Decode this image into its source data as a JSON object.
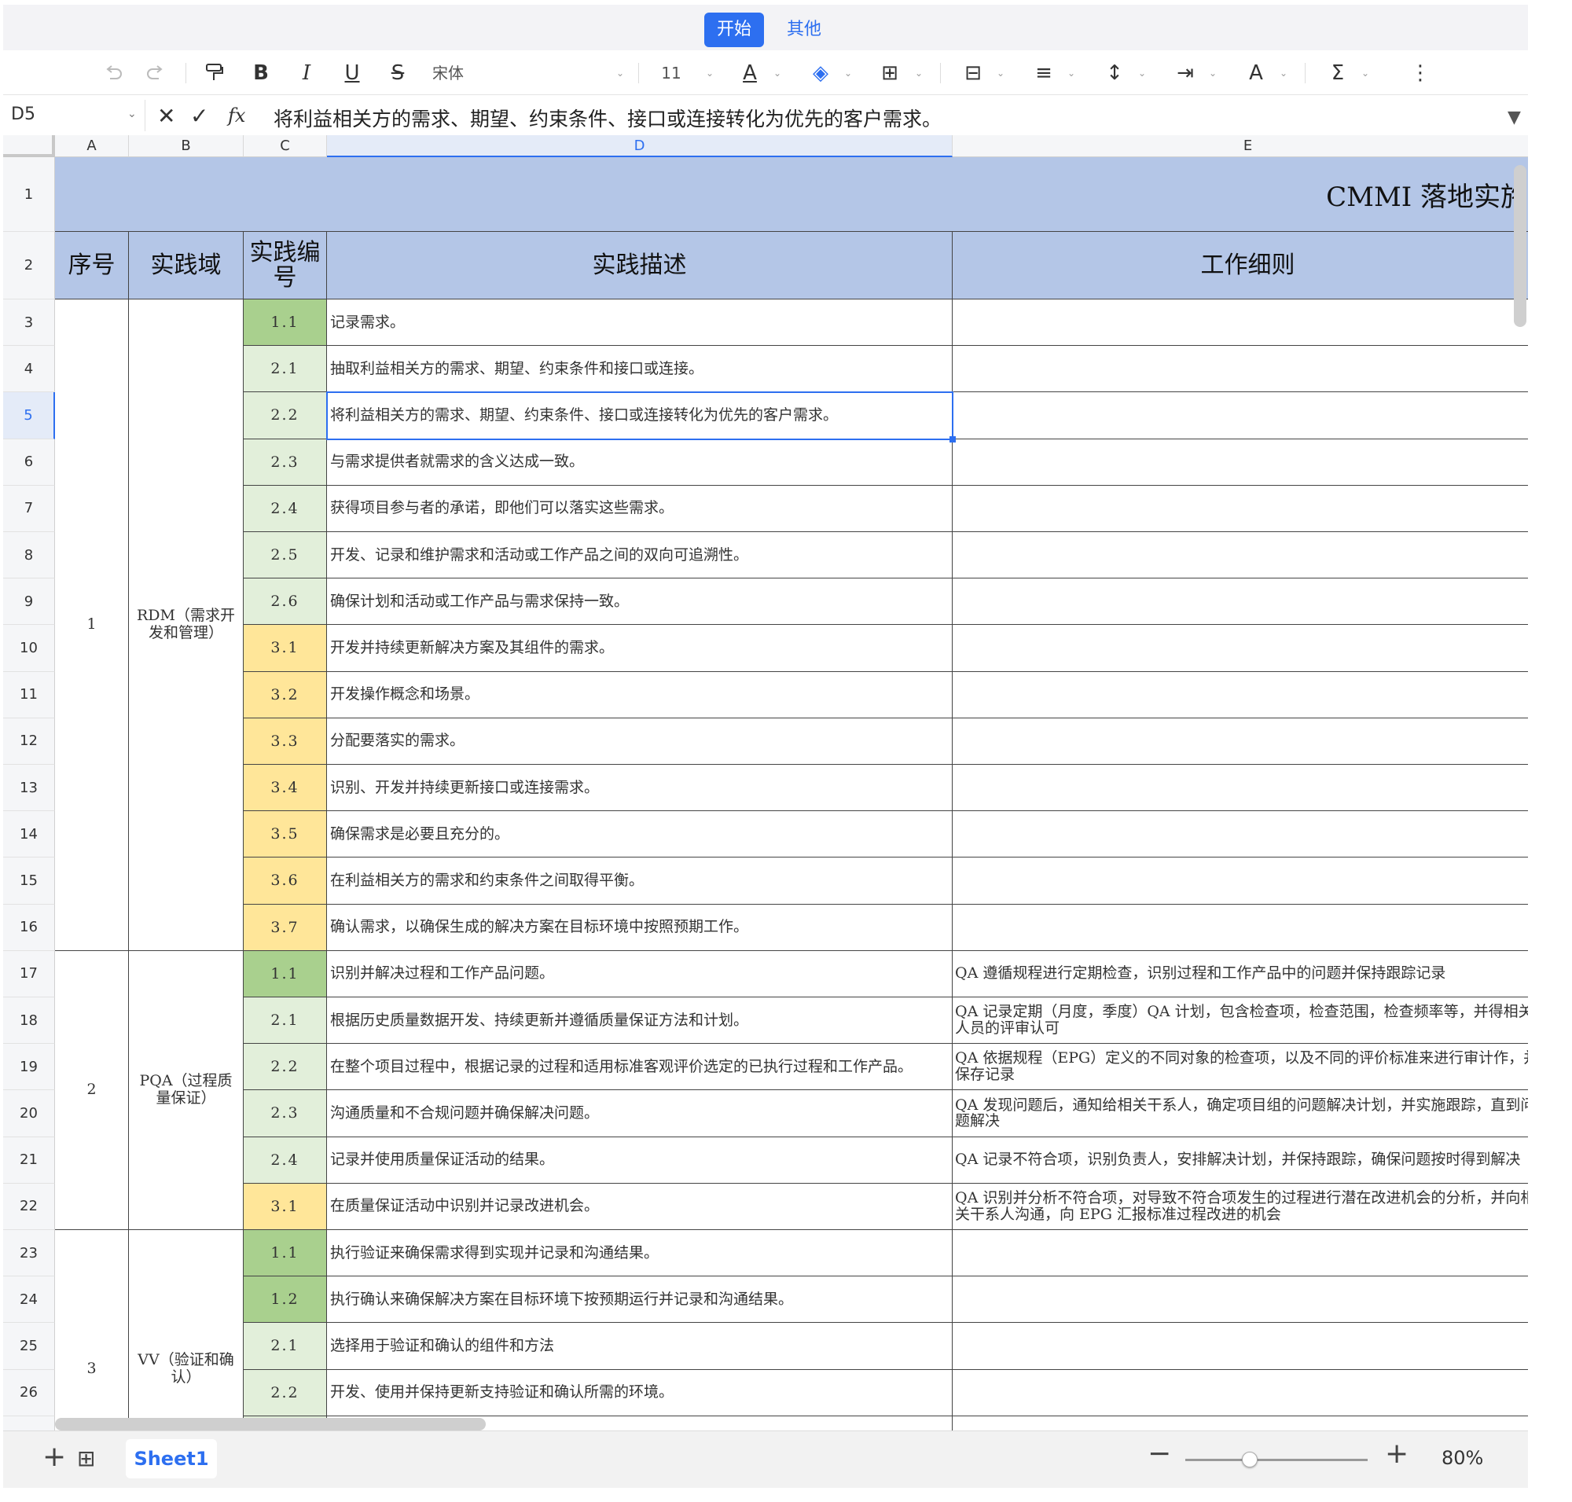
{
  "top_tabs": {
    "start": "开始",
    "other": "其他"
  },
  "toolbar": {
    "undo_icon": "undo-icon",
    "redo_icon": "redo-icon",
    "format_painter_icon": "format-painter-icon",
    "bold": "B",
    "italic": "I",
    "underline": "U",
    "strike": "S",
    "font_name": "宋体",
    "font_size": "11",
    "font_color_glyph": "A",
    "fill_glyph": "◈",
    "border_glyph": "⊞",
    "merge_glyph": "⊟",
    "align_glyph": "≡",
    "valign_glyph": "↕",
    "wrap_glyph": "⇥",
    "text_dir_glyph": "A",
    "sum_glyph": "Σ",
    "more_glyph": "⋮",
    "accent_color": "#2d6ff0"
  },
  "formula_bar": {
    "cell_ref": "D5",
    "cancel_glyph": "✕",
    "confirm_glyph": "✓",
    "fx_label": "fx",
    "content": "将利益相关方的需求、期望、约束条件、接口或连接转化为优先的客户需求。",
    "expand_glyph": "▼"
  },
  "columns": [
    "A",
    "B",
    "C",
    "D",
    "E"
  ],
  "selected_cell": "D5",
  "sheet": {
    "title": "CMMI 落地实施",
    "headers": [
      "序号",
      "实践域",
      "实践编号",
      "实践描述",
      "工作细则"
    ],
    "groups": [
      {
        "seq": "1",
        "domain": "RDM（需求开发和管理）"
      },
      {
        "seq": "2",
        "domain": "PQA（过程质量保证）"
      },
      {
        "seq": "3",
        "domain": "VV（验证和确认）"
      }
    ],
    "rows": [
      {
        "row": "3",
        "code": "1.1",
        "level": 1,
        "desc": "记录需求。",
        "detail": ""
      },
      {
        "row": "4",
        "code": "2.1",
        "level": 2,
        "desc": "抽取利益相关方的需求、期望、约束条件和接口或连接。",
        "detail": ""
      },
      {
        "row": "5",
        "code": "2.2",
        "level": 2,
        "desc": "将利益相关方的需求、期望、约束条件、接口或连接转化为优先的客户需求。",
        "detail": ""
      },
      {
        "row": "6",
        "code": "2.3",
        "level": 2,
        "desc": "与需求提供者就需求的含义达成一致。",
        "detail": ""
      },
      {
        "row": "7",
        "code": "2.4",
        "level": 2,
        "desc": "获得项目参与者的承诺，即他们可以落实这些需求。",
        "detail": ""
      },
      {
        "row": "8",
        "code": "2.5",
        "level": 2,
        "desc": "开发、记录和维护需求和活动或工作产品之间的双向可追溯性。",
        "detail": ""
      },
      {
        "row": "9",
        "code": "2.6",
        "level": 2,
        "desc": "确保计划和活动或工作产品与需求保持一致。",
        "detail": ""
      },
      {
        "row": "10",
        "code": "3.1",
        "level": 3,
        "desc": "开发并持续更新解决方案及其组件的需求。",
        "detail": ""
      },
      {
        "row": "11",
        "code": "3.2",
        "level": 3,
        "desc": "开发操作概念和场景。",
        "detail": ""
      },
      {
        "row": "12",
        "code": "3.3",
        "level": 3,
        "desc": "分配要落实的需求。",
        "detail": ""
      },
      {
        "row": "13",
        "code": "3.4",
        "level": 3,
        "desc": "识别、开发并持续更新接口或连接需求。",
        "detail": ""
      },
      {
        "row": "14",
        "code": "3.5",
        "level": 3,
        "desc": "确保需求是必要且充分的。",
        "detail": ""
      },
      {
        "row": "15",
        "code": "3.6",
        "level": 3,
        "desc": "在利益相关方的需求和约束条件之间取得平衡。",
        "detail": ""
      },
      {
        "row": "16",
        "code": "3.7",
        "level": 3,
        "desc": "确认需求，以确保生成的解决方案在目标环境中按照预期工作。",
        "detail": ""
      },
      {
        "row": "17",
        "code": "1.1",
        "level": 1,
        "desc": "识别并解决过程和工作产品问题。",
        "detail": "QA 遵循规程进行定期检查，识别过程和工作产品中的问题并保持跟踪记录"
      },
      {
        "row": "18",
        "code": "2.1",
        "level": 2,
        "desc": "根据历史质量数据开发、持续更新并遵循质量保证方法和计划。",
        "detail": "QA 记录定期（月度，季度）QA 计划，包含检查项，检查范围，检查频率等，并得相关人员的评审认可"
      },
      {
        "row": "19",
        "code": "2.2",
        "level": 2,
        "desc": "在整个项目过程中，根据记录的过程和适用标准客观评价选定的已执行过程和工作产品。",
        "detail": "QA 依据规程（EPG）定义的不同对象的检查项，以及不同的评价标准来进行审计作，并保存记录"
      },
      {
        "row": "20",
        "code": "2.3",
        "level": 2,
        "desc": "沟通质量和不合规问题并确保解决问题。",
        "detail": "QA 发现问题后，通知给相关干系人，确定项目组的问题解决计划，并实施跟踪，直到问题解决"
      },
      {
        "row": "21",
        "code": "2.4",
        "level": 2,
        "desc": "记录并使用质量保证活动的结果。",
        "detail": "QA 记录不符合项，识别负责人，安排解决计划，并保持跟踪，确保问题按时得到解决"
      },
      {
        "row": "22",
        "code": "3.1",
        "level": 3,
        "desc": "在质量保证活动中识别并记录改进机会。",
        "detail": "QA 识别并分析不符合项，对导致不符合项发生的过程进行潜在改进机会的分析，并向相关干系人沟通，向 EPG 汇报标准过程改进的机会"
      },
      {
        "row": "23",
        "code": "1.1",
        "level": 1,
        "desc": "执行验证来确保需求得到实现并记录和沟通结果。",
        "detail": ""
      },
      {
        "row": "24",
        "code": "1.2",
        "level": 1,
        "desc": "执行确认来确保解决方案在目标环境下按预期运行并记录和沟通结果。",
        "detail": ""
      },
      {
        "row": "25",
        "code": "2.1",
        "level": 2,
        "desc": "选择用于验证和确认的组件和方法",
        "detail": ""
      },
      {
        "row": "26",
        "code": "2.2",
        "level": 2,
        "desc": "开发、使用并保持更新支持验证和确认所需的环境。",
        "detail": ""
      }
    ],
    "level_colors": {
      "1": "#a9d08e",
      "2": "#e2efda",
      "3": "#ffe699"
    },
    "header_fill": "#b4c6e7"
  },
  "bottom_bar": {
    "add_glyph": "+",
    "sheet_list_glyph": "⊞",
    "sheet_tab": "Sheet1",
    "zoom_out_glyph": "−",
    "zoom_in_glyph": "+",
    "zoom_level": "80%",
    "zoom_fraction": 0.35
  }
}
